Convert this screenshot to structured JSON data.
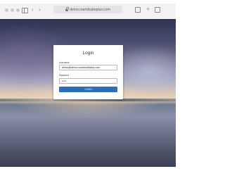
{
  "browser": {
    "url": "demo.roundcubeplus.com",
    "back_glyph": "‹",
    "forward_glyph": "›",
    "new_tab_glyph": "+"
  },
  "login": {
    "title": "Login",
    "username_label": "Username",
    "username_value": "demo@demo.roundcubeplus.com",
    "password_label": "Password",
    "password_value": "••••",
    "button_label": "LOGIN"
  },
  "colors": {
    "accent": "#2f6db4",
    "card_background": "#ffffff"
  }
}
